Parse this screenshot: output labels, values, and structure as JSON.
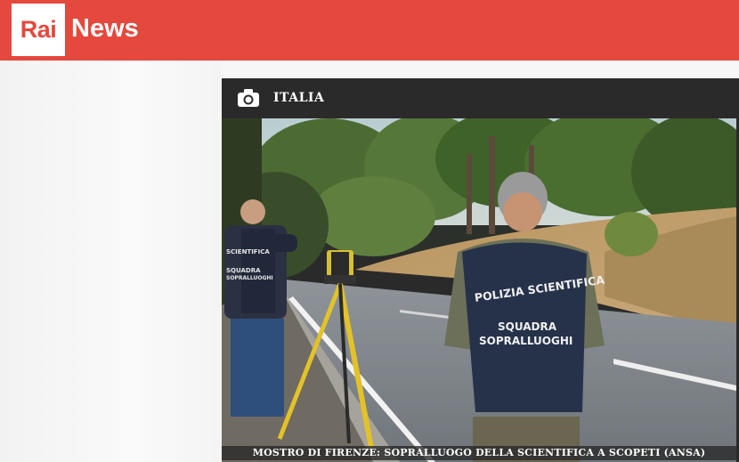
{
  "header": {
    "logo_rai": "Rai",
    "logo_news": "News",
    "brand_color": "#e5483c"
  },
  "card": {
    "section_icon": "camera-icon",
    "section_label": "ITALIA",
    "caption": "MOSTRO DI FIRENZE: SOPRALLUOGO DELLA SCIENTIFICA A SCOPETI (ANSA)",
    "photo": {
      "vest_line1": "POLIZIA SCIENTIFICA",
      "vest_line2": "SQUADRA",
      "vest_line3": "SOPRALLUOGHI",
      "side_vest_line1": "SCIENTIFICA",
      "side_vest_line2": "SQUADRA",
      "side_vest_line3": "SOPRALLUOGHI"
    }
  }
}
